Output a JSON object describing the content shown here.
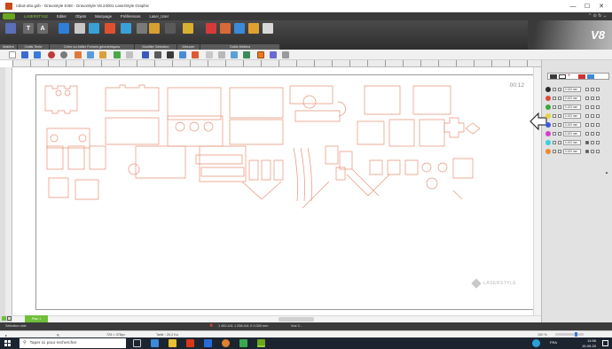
{
  "window": {
    "title": "robot-otto.gsb - Gravostyle 8 B8 - GravoStyle V8.24001 LaserStyle Graphic",
    "min_glyph": "—",
    "max_glyph": "☐",
    "close_glyph": "✕"
  },
  "menu": {
    "items": [
      "LASERSTYLE",
      "Editer",
      "Objets",
      "Marquage",
      "Préférences",
      "Laser_User"
    ],
    "right_text": "⌃ ⊙ ↻ ⌄"
  },
  "ribbon": {
    "groups": [
      "Matière",
      "Outils Texte",
      "Créer ou éditer Formes géométriques",
      "Modifier Sélection",
      "Mesurer",
      "Outils Métiers"
    ],
    "brand": "V8"
  },
  "canvas": {
    "timer": "00:12",
    "watermark": "LASERSTYLE"
  },
  "pens": [
    {
      "color": "#2a2a2a",
      "value": "0.100 mm",
      "checked": false
    },
    {
      "color": "#e04a3a",
      "value": "0.100 mm",
      "checked": false
    },
    {
      "color": "#3aa83a",
      "value": "0.100 mm",
      "checked": false
    },
    {
      "color": "#e8d23a",
      "value": "0.100 mm",
      "checked": false
    },
    {
      "color": "#3a5ae0",
      "value": "0.100 mm",
      "checked": false
    },
    {
      "color": "#d83ad0",
      "value": "0.100 mm",
      "checked": false
    },
    {
      "color": "#3ad0e0",
      "value": "0.100 mm",
      "checked": true
    },
    {
      "color": "#f08a2a",
      "value": "0.100 mm",
      "checked": true
    }
  ],
  "layer": {
    "name": "Plan 1"
  },
  "status": {
    "selection": "Sélection vide",
    "coords": "1 452.441  1 258.441  X 0.000 mm",
    "mode": "Vue 2...",
    "dimensions": "725 × 378px",
    "size": "Taille : 20,2 Ko",
    "zoom": "100 %"
  },
  "taskbar": {
    "search_placeholder": "Taper ici pour rechercher",
    "lang": "FRA",
    "time": "11:56",
    "date": "15-09-20"
  },
  "colors": {
    "cut_line": "#e8937a",
    "accent_green": "#6aa61e",
    "ribbon_bg": "#3a3a3a"
  }
}
